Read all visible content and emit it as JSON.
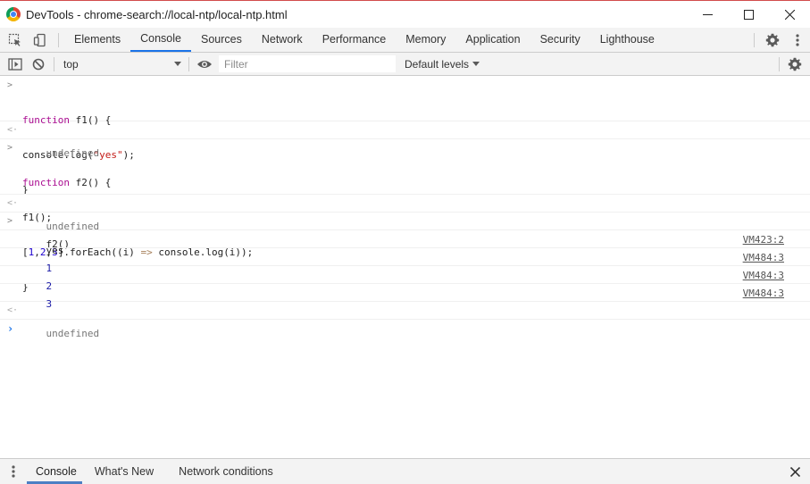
{
  "window": {
    "title": "DevTools - chrome-search://local-ntp/local-ntp.html",
    "controls": {
      "minimize": "—",
      "maximize": "☐",
      "close": "✕"
    }
  },
  "main_tabs": [
    {
      "label": "Elements",
      "active": false
    },
    {
      "label": "Console",
      "active": true
    },
    {
      "label": "Sources",
      "active": false
    },
    {
      "label": "Network",
      "active": false
    },
    {
      "label": "Performance",
      "active": false
    },
    {
      "label": "Memory",
      "active": false
    },
    {
      "label": "Application",
      "active": false
    },
    {
      "label": "Security",
      "active": false
    },
    {
      "label": "Lighthouse",
      "active": false
    }
  ],
  "console_toolbar": {
    "context": "top",
    "filter_placeholder": "Filter",
    "levels": "Default levels"
  },
  "console": {
    "f1_line1": "function f1() {",
    "f1_line2": "console.log(\"yes\");",
    "f1_line3": "}",
    "result1": "undefined",
    "f2_line1": "function f2() {",
    "f2_line2": "f1();",
    "f2_line3": "[1,2,3].forEach((i) => console.log(i));",
    "f2_line4": "}",
    "result2": "undefined",
    "call": "f2()",
    "logs": [
      {
        "text": "yes",
        "source": "VM423:2"
      },
      {
        "text": "1",
        "source": "VM484:3"
      },
      {
        "text": "2",
        "source": "VM484:3"
      },
      {
        "text": "3",
        "source": "VM484:3"
      }
    ],
    "result3": "undefined"
  },
  "drawer": {
    "tabs": [
      {
        "label": "Console",
        "active": true
      },
      {
        "label": "What's New",
        "active": false
      },
      {
        "label": "Network conditions",
        "active": false
      }
    ]
  },
  "colors": {
    "accent": "#1a73e8",
    "toolbar_bg": "#f3f3f3",
    "keyword": "#aa0d91",
    "string": "#c41a16",
    "number": "#1c00cf"
  },
  "icons": {
    "inspect": "inspect-element-icon",
    "device": "device-toolbar-icon",
    "settings": "gear-icon",
    "more": "kebab-menu-icon",
    "sidebar": "show-sidebar-icon",
    "clear": "clear-console-icon",
    "eye": "live-expression-eye-icon",
    "close": "close-icon"
  }
}
